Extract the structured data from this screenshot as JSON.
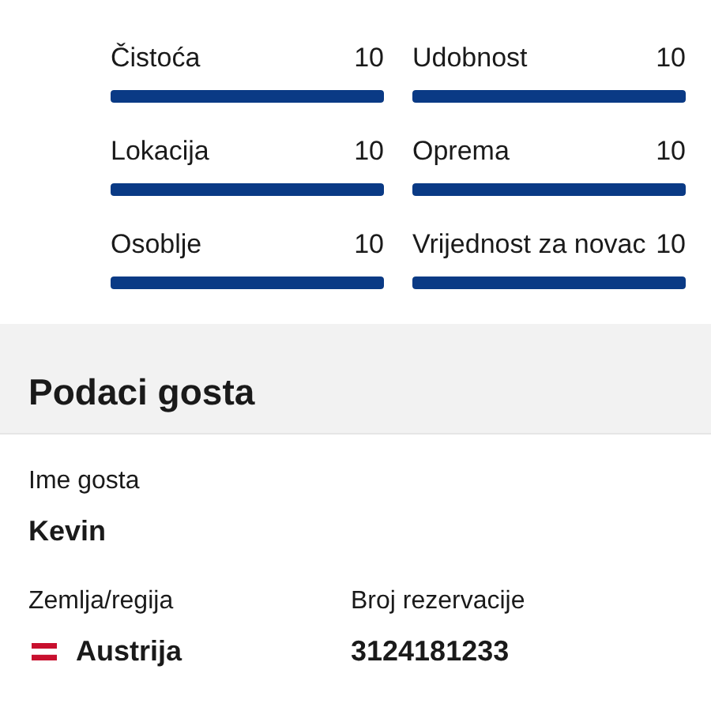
{
  "ratings": [
    {
      "label": "Čistoća",
      "score": "10",
      "level": 1
    },
    {
      "label": "Udobnost",
      "score": "10",
      "level": 1
    },
    {
      "label": "Lokacija",
      "score": "10",
      "level": 1
    },
    {
      "label": "Oprema",
      "score": "10",
      "level": 1
    },
    {
      "label": "Osoblje",
      "score": "10",
      "level": 1
    },
    {
      "label": "Vrijednost za novac",
      "score": "10",
      "level": 1
    }
  ],
  "guest_section": {
    "title": "Podaci gosta",
    "guest_name": {
      "label": "Ime gosta",
      "value": "Kevin"
    },
    "country": {
      "label": "Zemlja/regija",
      "value": "Austrija"
    },
    "booking_number": {
      "label": "Broj rezervacije",
      "value": "3124181233"
    }
  }
}
